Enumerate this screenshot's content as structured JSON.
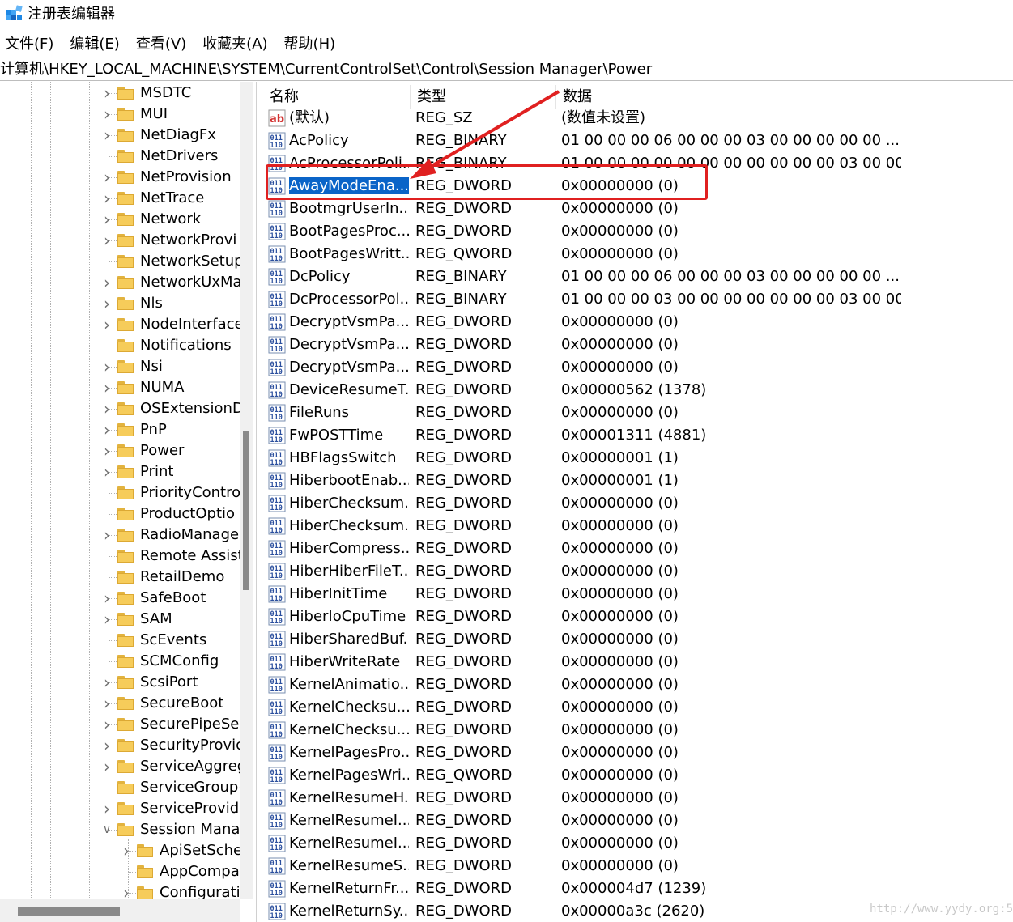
{
  "window": {
    "title": "注册表编辑器"
  },
  "menu": [
    "文件(F)",
    "编辑(E)",
    "查看(V)",
    "收藏夹(A)",
    "帮助(H)"
  ],
  "address": "计算机\\HKEY_LOCAL_MACHINE\\SYSTEM\\CurrentControlSet\\Control\\Session Manager\\Power",
  "tree": [
    {
      "label": "MSDTC",
      "expandable": true
    },
    {
      "label": "MUI",
      "expandable": true
    },
    {
      "label": "NetDiagFx",
      "expandable": true
    },
    {
      "label": "NetDrivers",
      "expandable": false
    },
    {
      "label": "NetProvision",
      "expandable": true
    },
    {
      "label": "NetTrace",
      "expandable": true
    },
    {
      "label": "Network",
      "expandable": true
    },
    {
      "label": "NetworkProvi",
      "expandable": true
    },
    {
      "label": "NetworkSetup",
      "expandable": false
    },
    {
      "label": "NetworkUxMa",
      "expandable": true
    },
    {
      "label": "Nls",
      "expandable": true
    },
    {
      "label": "NodeInterface",
      "expandable": true
    },
    {
      "label": "Notifications",
      "expandable": false
    },
    {
      "label": "Nsi",
      "expandable": true
    },
    {
      "label": "NUMA",
      "expandable": true
    },
    {
      "label": "OSExtensionD",
      "expandable": true
    },
    {
      "label": "PnP",
      "expandable": true
    },
    {
      "label": "Power",
      "expandable": true
    },
    {
      "label": "Print",
      "expandable": true
    },
    {
      "label": "PriorityContro",
      "expandable": false
    },
    {
      "label": "ProductOptio",
      "expandable": false
    },
    {
      "label": "RadioManage",
      "expandable": true
    },
    {
      "label": "Remote Assist",
      "expandable": false
    },
    {
      "label": "RetailDemo",
      "expandable": false
    },
    {
      "label": "SafeBoot",
      "expandable": true
    },
    {
      "label": "SAM",
      "expandable": true
    },
    {
      "label": "ScEvents",
      "expandable": false
    },
    {
      "label": "SCMConfig",
      "expandable": false
    },
    {
      "label": "ScsiPort",
      "expandable": true
    },
    {
      "label": "SecureBoot",
      "expandable": true
    },
    {
      "label": "SecurePipeSer",
      "expandable": true
    },
    {
      "label": "SecurityProvic",
      "expandable": true
    },
    {
      "label": "ServiceAggreg",
      "expandable": true
    },
    {
      "label": "ServiceGroup(",
      "expandable": false
    },
    {
      "label": "ServiceProvide",
      "expandable": true
    },
    {
      "label": "Session Mana",
      "expandable": true,
      "expanded": true
    },
    {
      "label": "ApiSetSche",
      "expandable": true,
      "child": true
    },
    {
      "label": "AppCompa",
      "expandable": false,
      "child": true
    },
    {
      "label": "Configurati",
      "expandable": true,
      "child": true
    }
  ],
  "columns": {
    "name": "名称",
    "type": "类型",
    "data": "数据"
  },
  "values": [
    {
      "icon": "ab",
      "name": "(默认)",
      "type": "REG_SZ",
      "data": "(数值未设置)"
    },
    {
      "icon": "bin",
      "name": "AcPolicy",
      "type": "REG_BINARY",
      "data": "01 00 00 00 06 00 00 00 03 00 00 00 00 00 ..."
    },
    {
      "icon": "bin",
      "name": "AcProcessorPoli...",
      "type": "REG_BINARY",
      "data": "01 00 00 00 00 00 00 00 00 00 00 00 03 00 00 ..."
    },
    {
      "icon": "bin",
      "name": "AwayModeEna...",
      "type": "REG_DWORD",
      "data": "0x00000000 (0)",
      "selected": true
    },
    {
      "icon": "bin",
      "name": "BootmgrUserIn...",
      "type": "REG_DWORD",
      "data": "0x00000000 (0)"
    },
    {
      "icon": "bin",
      "name": "BootPagesProc...",
      "type": "REG_DWORD",
      "data": "0x00000000 (0)"
    },
    {
      "icon": "bin",
      "name": "BootPagesWritt...",
      "type": "REG_QWORD",
      "data": "0x00000000 (0)"
    },
    {
      "icon": "bin",
      "name": "DcPolicy",
      "type": "REG_BINARY",
      "data": "01 00 00 00 06 00 00 00 03 00 00 00 00 00 ..."
    },
    {
      "icon": "bin",
      "name": "DcProcessorPol...",
      "type": "REG_BINARY",
      "data": "01 00 00 00 03 00 00 00 00 00 00 00 03 00 00 ..."
    },
    {
      "icon": "bin",
      "name": "DecryptVsmPa...",
      "type": "REG_DWORD",
      "data": "0x00000000 (0)"
    },
    {
      "icon": "bin",
      "name": "DecryptVsmPa...",
      "type": "REG_DWORD",
      "data": "0x00000000 (0)"
    },
    {
      "icon": "bin",
      "name": "DecryptVsmPa...",
      "type": "REG_DWORD",
      "data": "0x00000000 (0)"
    },
    {
      "icon": "bin",
      "name": "DeviceResumeT...",
      "type": "REG_DWORD",
      "data": "0x00000562 (1378)"
    },
    {
      "icon": "bin",
      "name": "FileRuns",
      "type": "REG_DWORD",
      "data": "0x00000000 (0)"
    },
    {
      "icon": "bin",
      "name": "FwPOSTTime",
      "type": "REG_DWORD",
      "data": "0x00001311 (4881)"
    },
    {
      "icon": "bin",
      "name": "HBFlagsSwitch",
      "type": "REG_DWORD",
      "data": "0x00000001 (1)"
    },
    {
      "icon": "bin",
      "name": "HiberbootEnab...",
      "type": "REG_DWORD",
      "data": "0x00000001 (1)"
    },
    {
      "icon": "bin",
      "name": "HiberChecksum...",
      "type": "REG_DWORD",
      "data": "0x00000000 (0)"
    },
    {
      "icon": "bin",
      "name": "HiberChecksum...",
      "type": "REG_DWORD",
      "data": "0x00000000 (0)"
    },
    {
      "icon": "bin",
      "name": "HiberCompress...",
      "type": "REG_DWORD",
      "data": "0x00000000 (0)"
    },
    {
      "icon": "bin",
      "name": "HiberHiberFileT...",
      "type": "REG_DWORD",
      "data": "0x00000000 (0)"
    },
    {
      "icon": "bin",
      "name": "HiberInitTime",
      "type": "REG_DWORD",
      "data": "0x00000000 (0)"
    },
    {
      "icon": "bin",
      "name": "HiberIoCpuTime",
      "type": "REG_DWORD",
      "data": "0x00000000 (0)"
    },
    {
      "icon": "bin",
      "name": "HiberSharedBuf...",
      "type": "REG_DWORD",
      "data": "0x00000000 (0)"
    },
    {
      "icon": "bin",
      "name": "HiberWriteRate",
      "type": "REG_DWORD",
      "data": "0x00000000 (0)"
    },
    {
      "icon": "bin",
      "name": "KernelAnimatio...",
      "type": "REG_DWORD",
      "data": "0x00000000 (0)"
    },
    {
      "icon": "bin",
      "name": "KernelChecksu...",
      "type": "REG_DWORD",
      "data": "0x00000000 (0)"
    },
    {
      "icon": "bin",
      "name": "KernelChecksu...",
      "type": "REG_DWORD",
      "data": "0x00000000 (0)"
    },
    {
      "icon": "bin",
      "name": "KernelPagesPro...",
      "type": "REG_DWORD",
      "data": "0x00000000 (0)"
    },
    {
      "icon": "bin",
      "name": "KernelPagesWri...",
      "type": "REG_QWORD",
      "data": "0x00000000 (0)"
    },
    {
      "icon": "bin",
      "name": "KernelResumeH...",
      "type": "REG_DWORD",
      "data": "0x00000000 (0)"
    },
    {
      "icon": "bin",
      "name": "KernelResumeI...",
      "type": "REG_DWORD",
      "data": "0x00000000 (0)"
    },
    {
      "icon": "bin",
      "name": "KernelResumeI...",
      "type": "REG_DWORD",
      "data": "0x00000000 (0)"
    },
    {
      "icon": "bin",
      "name": "KernelResumeS...",
      "type": "REG_DWORD",
      "data": "0x00000000 (0)"
    },
    {
      "icon": "bin",
      "name": "KernelReturnFr...",
      "type": "REG_DWORD",
      "data": "0x000004d7 (1239)"
    },
    {
      "icon": "bin",
      "name": "KernelReturnSy...",
      "type": "REG_DWORD",
      "data": "0x00000a3c (2620)"
    }
  ],
  "annotation": {
    "color": "#e02020"
  },
  "watermark": "http://www.yydy.org:5",
  "colors": {
    "selection": "#0a64c8",
    "folder": "#f6cc5a"
  }
}
